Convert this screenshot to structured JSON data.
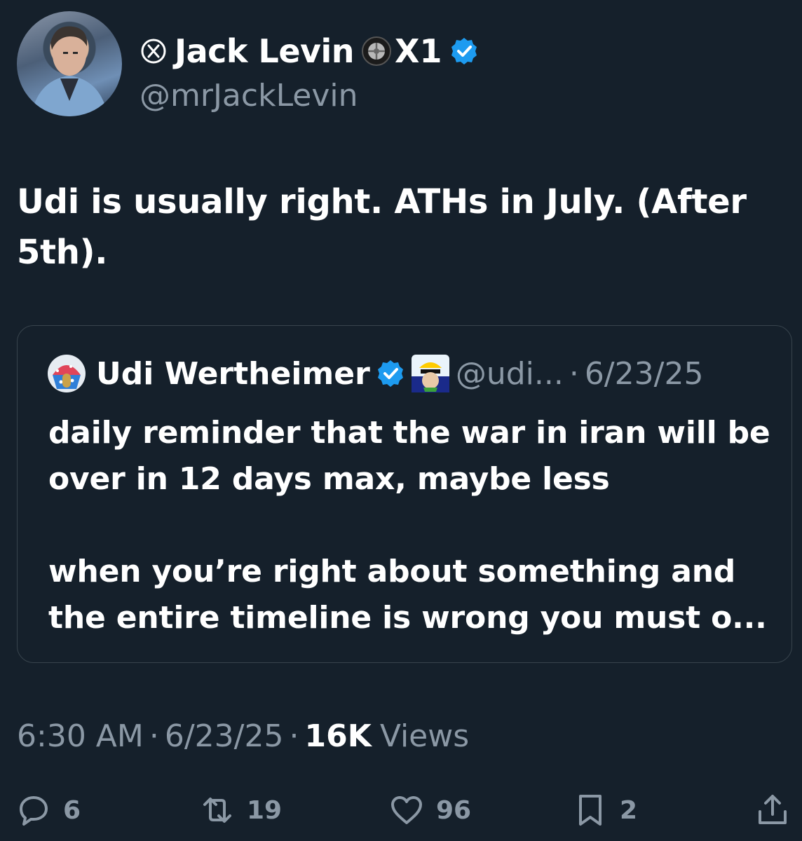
{
  "author": {
    "display_name": "Jack Levin",
    "affiliation": "X1",
    "handle": "@mrJackLevin"
  },
  "tweet": {
    "text": "Udi is usually right.  ATHs in July. (After 5th)."
  },
  "quote": {
    "name": "Udi Wertheimer",
    "handle": "@udi...",
    "separator": "·",
    "date": "6/23/25",
    "body": "daily reminder that the war in iran will be over in 12 days max, maybe less\n\nwhen you’re right about something and the entire timeline is wrong you must o..."
  },
  "meta": {
    "time": "6:30 AM",
    "separator": "·",
    "date": "6/23/25",
    "views_count": "16K",
    "views_label": "Views"
  },
  "actions": {
    "replies": "6",
    "reposts": "19",
    "likes": "96",
    "bookmarks": "2"
  },
  "colors": {
    "background": "#15202b",
    "muted_text": "#8b98a5",
    "verified_blue": "#1d9bf0",
    "border": "#38444d"
  }
}
